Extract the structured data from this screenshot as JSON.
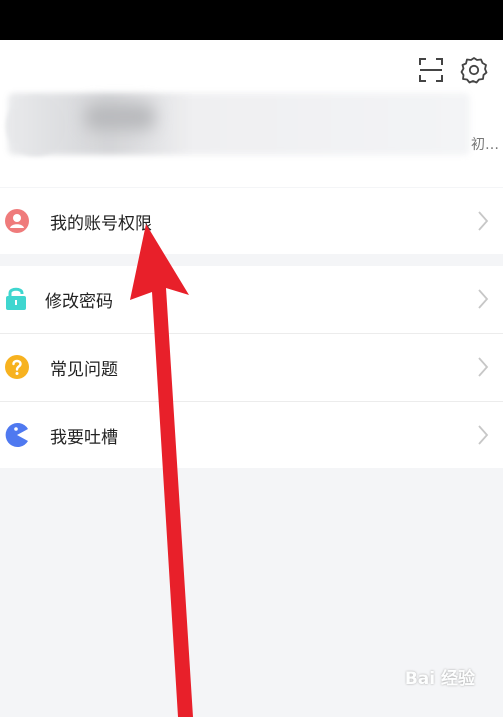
{
  "profile": {
    "name_tail": "初…"
  },
  "menu": {
    "section1": [
      {
        "label": "我的账号权限",
        "icon": "user-icon"
      }
    ],
    "section2": [
      {
        "label": "修改密码",
        "icon": "lock-icon"
      },
      {
        "label": "常见问题",
        "icon": "question-icon"
      },
      {
        "label": "我要吐槽",
        "icon": "pacman-icon"
      }
    ]
  },
  "colors": {
    "user_icon": "#ef7b7b",
    "lock_icon": "#3fd6cf",
    "question_icon": "#f7b21f",
    "pacman_icon": "#4f79f0",
    "arrow": "#e8202a"
  },
  "watermark": {
    "text": "Bai 经验"
  }
}
